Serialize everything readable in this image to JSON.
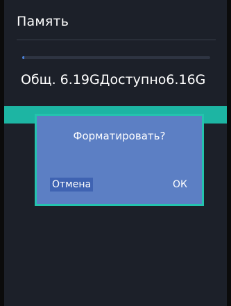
{
  "screen": {
    "title": "Память",
    "storage_text": "Общ. 6.19GДоступно6.16G",
    "used_fraction": 0.005
  },
  "dialog": {
    "question": "Форматировать?",
    "cancel_label": "Отмена",
    "ok_label": "ОК"
  },
  "colors": {
    "background": "#1c2029",
    "accent_teal": "#1db5a3",
    "dialog_bg": "#5c7fc4",
    "dialog_border": "#24c3ae",
    "progress_fill": "#4a7fd4"
  }
}
